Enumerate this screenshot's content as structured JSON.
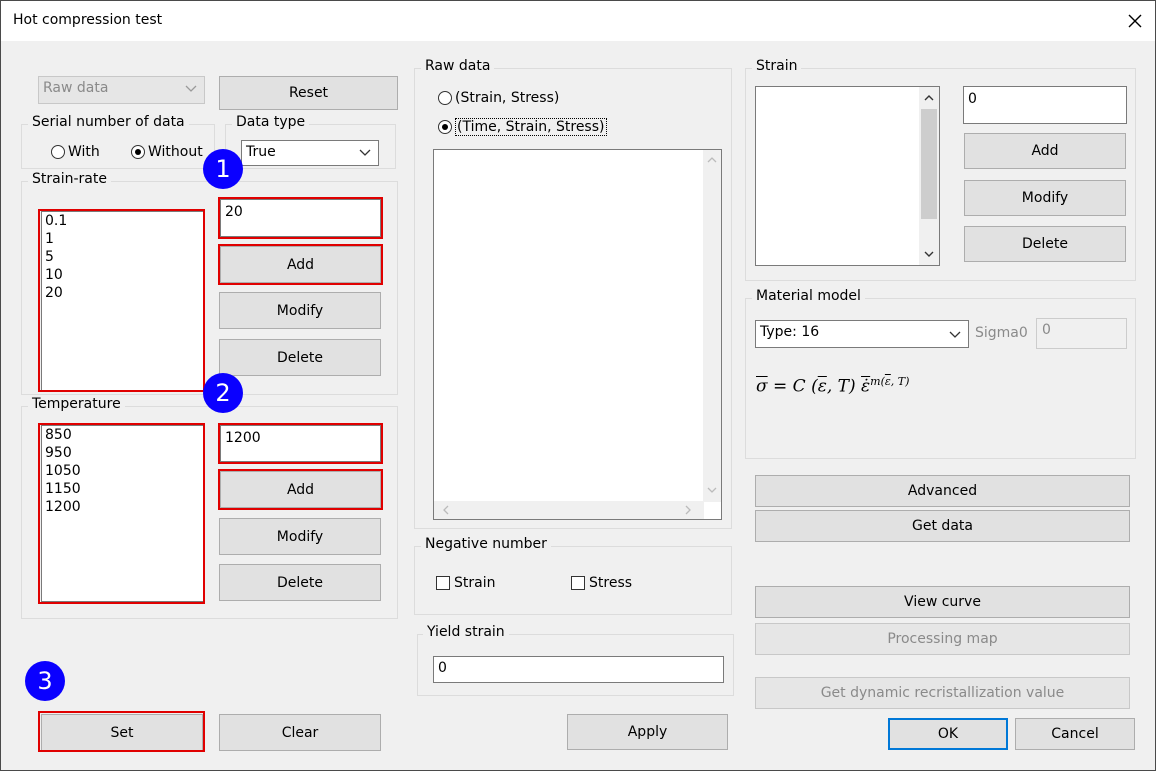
{
  "window": {
    "title": "Hot compression test"
  },
  "left": {
    "source_select": {
      "value": "Raw data"
    },
    "reset_label": "Reset",
    "serial_group": {
      "label": "Serial number of data",
      "with_label": "With",
      "without_label": "Without",
      "selected": "Without"
    },
    "datatype_group": {
      "label": "Data type",
      "value": "True"
    },
    "strain_rate": {
      "label": "Strain-rate",
      "items": [
        "0.1",
        "1",
        "5",
        "10",
        "20"
      ],
      "input_value": "20",
      "add_label": "Add",
      "modify_label": "Modify",
      "delete_label": "Delete"
    },
    "temperature": {
      "label": "Temperature",
      "items": [
        "850",
        "950",
        "1050",
        "1150",
        "1200"
      ],
      "input_value": "1200",
      "add_label": "Add",
      "modify_label": "Modify",
      "delete_label": "Delete"
    },
    "set_label": "Set",
    "clear_label": "Clear"
  },
  "middle": {
    "raw_data": {
      "label": "Raw data",
      "option1": "(Strain, Stress)",
      "option2": "(Time, Strain, Stress)",
      "selected": "(Time, Strain, Stress)"
    },
    "negative": {
      "label": "Negative number",
      "strain_label": "Strain",
      "stress_label": "Stress"
    },
    "yield_strain": {
      "label": "Yield strain",
      "value": "0"
    },
    "apply_label": "Apply"
  },
  "right": {
    "strain": {
      "label": "Strain",
      "input_value": "0",
      "add_label": "Add",
      "modify_label": "Modify",
      "delete_label": "Delete"
    },
    "material_model": {
      "label": "Material model",
      "type_value": "Type: 16",
      "sigma_label": "Sigma0",
      "sigma_value": "0"
    },
    "advanced_label": "Advanced",
    "get_data_label": "Get data",
    "view_curve_label": "View curve",
    "processing_map_label": "Processing map",
    "get_drx_label": "Get dynamic recristallization value",
    "ok_label": "OK",
    "cancel_label": "Cancel"
  },
  "annotations": {
    "badge1": "1",
    "badge2": "2",
    "badge3": "3"
  },
  "colors": {
    "highlight": "#e00000",
    "badge": "#0a00ff",
    "default_button_border": "#0078d7"
  }
}
